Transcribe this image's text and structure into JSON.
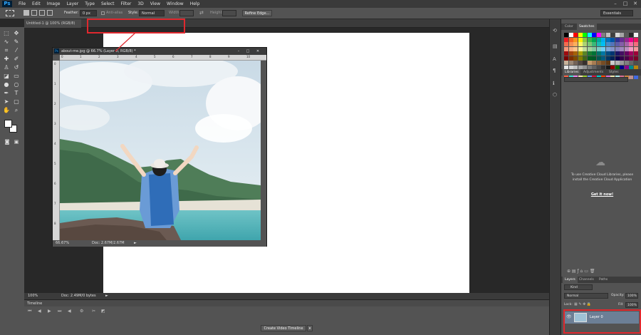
{
  "app": {
    "logo": "Ps"
  },
  "menu": [
    "File",
    "Edit",
    "Image",
    "Layer",
    "Type",
    "Select",
    "Filter",
    "3D",
    "View",
    "Window",
    "Help"
  ],
  "window_controls": [
    "–",
    "□",
    "✕"
  ],
  "options": {
    "feather_label": "Feather:",
    "feather_value": "0 px",
    "antialias_label": "Anti-alias",
    "style_label": "Style:",
    "style_value": "Normal",
    "width_label": "Width:",
    "height_label": "Height:",
    "refine_edge": "Refine Edge...",
    "workspace": "Essentials"
  },
  "main_doc": {
    "tab": "Untitled-1 @ 100% (RGB/8)",
    "zoom": "100%",
    "doc_info": "Doc: 2.49M/0 bytes"
  },
  "float_doc": {
    "title": "about-me.jpg @ 66.7% (Layer 0, RGB/8) *",
    "zoom": "66.67%",
    "doc_info": "Doc: 2.67M/2.67M",
    "hruler_ticks": [
      "0",
      "1",
      "2",
      "3",
      "4",
      "5",
      "6",
      "7",
      "8",
      "9",
      "10"
    ],
    "vruler_ticks": [
      "0",
      "1",
      "2",
      "3",
      "4",
      "5",
      "6",
      "7",
      "8"
    ]
  },
  "timeline": {
    "label": "Timeline",
    "create_button": "Create Video Timeline"
  },
  "panels": {
    "color_tab": "Color",
    "swatches_tab": "Swatches",
    "libraries_tab": "Libraries",
    "adjustments_tab": "Adjustments",
    "styles_tab": "Styles",
    "cc_message": "To use Creative Cloud Libraries, please install the Creative Cloud Application",
    "get_it_now": "Get it now!",
    "layers_tab": "Layers",
    "channels_tab": "Channels",
    "paths_tab": "Paths",
    "kind_filter": "Kind",
    "blend_mode": "Normal",
    "opacity_label": "Opacity:",
    "opacity_value": "100%",
    "lock_label": "Lock:",
    "fill_label": "Fill:",
    "fill_value": "100%",
    "layer_name": "Layer 0"
  },
  "colors": {
    "highlight": "#e0282e",
    "panel": "#535353",
    "dark": "#282828"
  },
  "swatch_colors": [
    "#000000",
    "#ffffff",
    "#ff0000",
    "#ffff00",
    "#00ff00",
    "#00ffff",
    "#0000ff",
    "#ff00ff",
    "#7f7f7f",
    "#bfbfbf",
    "#3f3f3f",
    "#d9d9d9",
    "#a6a6a6",
    "#595959",
    "#262626",
    "#f2f2f2",
    "#ed1c24",
    "#f26522",
    "#f7941d",
    "#fff200",
    "#8dc63f",
    "#39b54a",
    "#00a651",
    "#00a99d",
    "#00aeef",
    "#0072bc",
    "#0054a6",
    "#2e3192",
    "#662d91",
    "#92278f",
    "#ec008c",
    "#ed145b",
    "#f26c4f",
    "#f68e55",
    "#fbaf5c",
    "#fff467",
    "#acd372",
    "#7cc576",
    "#3bb878",
    "#1abbb4",
    "#00bff3",
    "#438ccb",
    "#5574b9",
    "#605ca8",
    "#855fa8",
    "#a763a8",
    "#f06ea9",
    "#f26d7d",
    "#f7977a",
    "#f9ad81",
    "#fdc68a",
    "#fff79a",
    "#c4df9b",
    "#a3d39c",
    "#82ca9d",
    "#7bcdc8",
    "#6ecff6",
    "#7ea7d8",
    "#8493ca",
    "#8882be",
    "#a187be",
    "#bc8dbf",
    "#f49ac2",
    "#f5989d",
    "#9e0b0f",
    "#a0410d",
    "#a36209",
    "#aba000",
    "#598527",
    "#1a7b30",
    "#007236",
    "#00746b",
    "#0076a3",
    "#004b80",
    "#003471",
    "#1b1464",
    "#440e62",
    "#630460",
    "#9e005d",
    "#9e0039",
    "#790000",
    "#7b2e00",
    "#7d4900",
    "#827b00",
    "#406618",
    "#005e20",
    "#005826",
    "#005952",
    "#005b7f",
    "#003663",
    "#002157",
    "#0d004c",
    "#32004b",
    "#4b0049",
    "#7b0046",
    "#7a0026",
    "#c7b299",
    "#998675",
    "#736357",
    "#534741",
    "#37302d",
    "#c69c6d",
    "#a67c52",
    "#8c6239",
    "#754c24",
    "#603913",
    "#cccccc",
    "#b3b3b3",
    "#999999",
    "#808080",
    "#666666",
    "#4d4d4d",
    "#e6e6e6",
    "#d4d4d4",
    "#c0c0c0",
    "#a8a8a8",
    "#909090",
    "#787878",
    "#606060",
    "#484848",
    "#303030",
    "#181818",
    "#8b0000",
    "#006400",
    "#00008b",
    "#8b008b",
    "#008b8b",
    "#b8860b",
    "#ffd700",
    "#ff8c00",
    "#ff1493",
    "#9400d3",
    "#1e90ff",
    "#32cd32",
    "#ffa07a",
    "#20b2aa",
    "#87cefa",
    "#778899",
    "#b0c4de",
    "#ffffe0",
    "#f0e68c",
    "#e6e6fa",
    "#dda0dd",
    "#98fb98",
    "#ff6347",
    "#40e0d0",
    "#ee82ee",
    "#f5deb3",
    "#9acd32",
    "#6495ed",
    "#dc143c",
    "#00ced1",
    "#ff4500",
    "#da70d6",
    "#eee8aa",
    "#afeeee",
    "#db7093",
    "#cd853f",
    "#bc8f8f",
    "#4169e1"
  ]
}
